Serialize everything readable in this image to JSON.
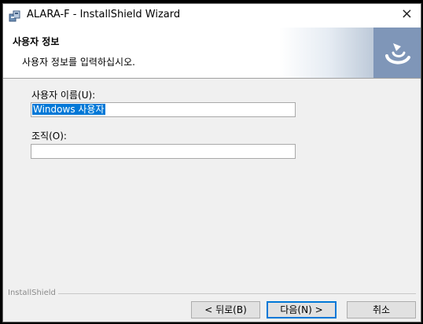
{
  "window": {
    "title": "ALARA-F - InstallShield Wizard",
    "close_glyph": "×"
  },
  "header": {
    "title": "사용자 정보",
    "subtitle": "사용자 정보를 입력하십시오."
  },
  "form": {
    "user_name_label": "사용자 이름(U):",
    "user_name_value": "Windows 사용자",
    "org_label": "조직(O):",
    "org_value": ""
  },
  "footer": {
    "brand": "InstallShield",
    "back_label": "< 뒤로(B)",
    "next_label": "다음(N) >",
    "cancel_label": "취소"
  },
  "icons": {
    "app": "installer-icon",
    "header": "installshield-logo-icon",
    "close": "close-icon"
  },
  "colors": {
    "selection": "#0078d7",
    "header_logo": "#7f96b8",
    "dialog_bg": "#f0f0f0"
  }
}
